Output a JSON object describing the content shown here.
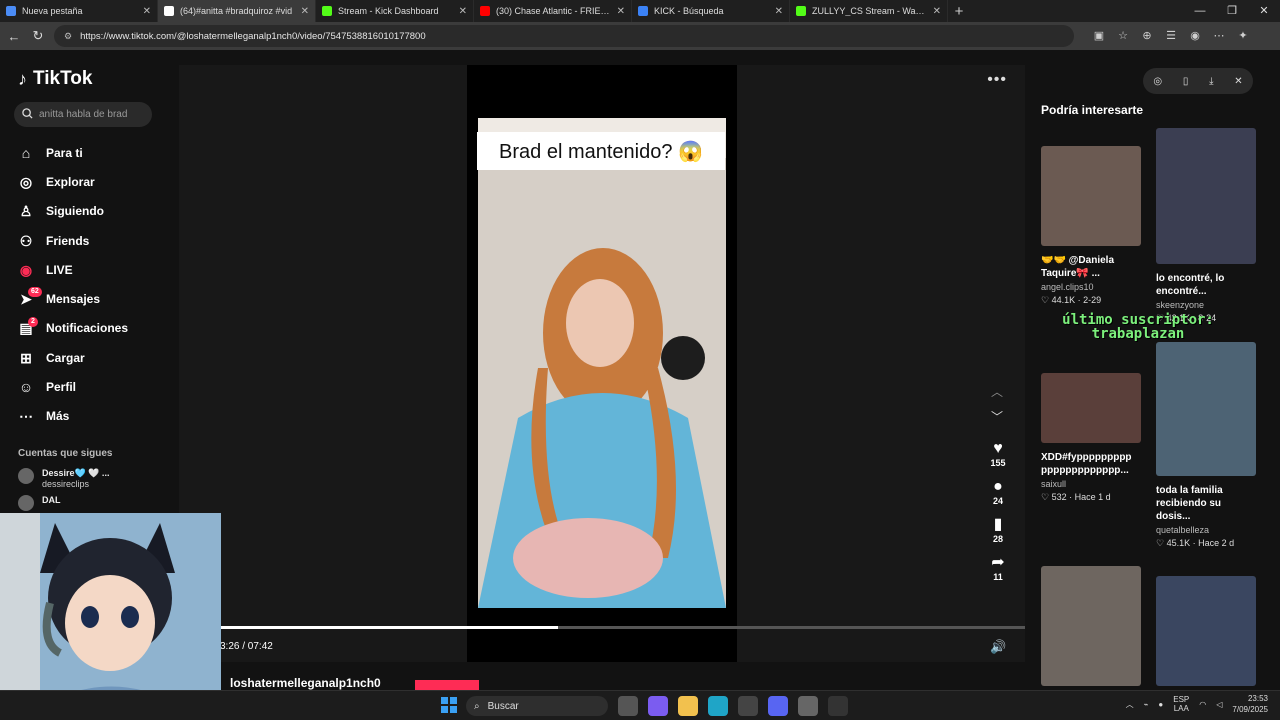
{
  "browser": {
    "tabs": [
      {
        "title": "Nueva pestaña",
        "color": "#4b8cf5",
        "active": false
      },
      {
        "title": "(64)#anitta #bradquiroz #vid",
        "color": "#ffffff",
        "active": true
      },
      {
        "title": "Stream - Kick Dashboard",
        "color": "#53fc18",
        "active": false
      },
      {
        "title": "(30) Chase Atlantic - FRIENDS (O",
        "color": "#ff0000",
        "active": false
      },
      {
        "title": "KICK - Búsqueda",
        "color": "#3b82f6",
        "active": false
      },
      {
        "title": "ZULLYY_CS Stream - Watch Live o",
        "color": "#53fc18",
        "active": false
      }
    ],
    "url": "https://www.tiktok.com/@loshatermelleganalp1nch0/video/7547538816010177800"
  },
  "tiktok": {
    "logo": "TikTok",
    "search_placeholder": "anitta habla de brad",
    "nav": [
      {
        "label": "Para ti",
        "icon": "home-icon"
      },
      {
        "label": "Explorar",
        "icon": "compass-icon"
      },
      {
        "label": "Siguiendo",
        "icon": "user-follow-icon"
      },
      {
        "label": "Friends",
        "icon": "friends-icon"
      },
      {
        "label": "LIVE",
        "icon": "live-icon"
      },
      {
        "label": "Mensajes",
        "icon": "message-icon",
        "badge": "62"
      },
      {
        "label": "Notificaciones",
        "icon": "notification-icon",
        "badge": "2"
      },
      {
        "label": "Cargar",
        "icon": "upload-icon"
      },
      {
        "label": "Perfil",
        "icon": "profile-icon"
      },
      {
        "label": "Más",
        "icon": "more-icon"
      }
    ],
    "following_title": "Cuentas que sigues",
    "following": [
      {
        "name": "Dessire🩵 🤍 ...",
        "handle": "dessireclips"
      },
      {
        "name": "DAL",
        "handle": ""
      }
    ],
    "video": {
      "caption": "Brad el mantenido? 😱",
      "time": "3:26 / 07:42",
      "progress": 0.42,
      "author_peek": "loshatermelleganalp1nch0",
      "likes": "155",
      "comments": "24",
      "saves": "28",
      "shares": "11"
    },
    "right": {
      "title": "Podría interesarte",
      "overlay": "último suscriptor:\ntrabaplazan",
      "cards": [
        {
          "title": "🤝🤝 @Daniela Taquire🎀 ...",
          "author": "angel.clips10",
          "meta": "♡ 44.1K · 2-29",
          "thumb": "#6b5a52"
        },
        {
          "title": "lo encontré, lo encontré...",
          "author": "skeenzyone",
          "meta": "♡ 42.1K · 8-24",
          "thumb": "#3b3e52"
        },
        {
          "title": "XDD#fyppppppppp ppppppppppppp...",
          "author": "saixull",
          "meta": "♡ 532 · Hace 1 d",
          "thumb": "#5a3f3a"
        },
        {
          "title": "toda la familia recibiendo su dosis...",
          "author": "quetalbelleza",
          "meta": "♡ 45.1K · Hace 2 d",
          "thumb": "#4d6374"
        },
        {
          "title": "",
          "author": "",
          "meta": "",
          "thumb": "#6e6660"
        },
        {
          "title": "",
          "author": "",
          "meta": "",
          "thumb": "#3a4660"
        }
      ]
    }
  },
  "taskbar": {
    "search": "Buscar",
    "lang": "ESP\nLAA",
    "time": "23:53",
    "date": "7/09/2025"
  }
}
